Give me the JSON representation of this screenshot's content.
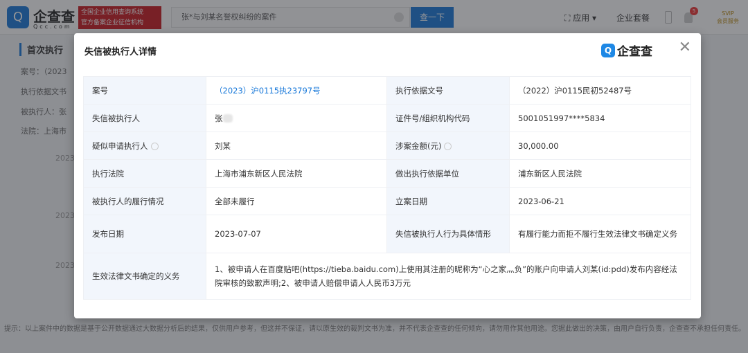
{
  "header": {
    "logo_text": "企查查",
    "logo_sub": "Qcc.com",
    "promo": [
      "全国企业信用查询系统",
      "官方备案企业征信机构"
    ],
    "search_value": "张*与刘某名誉权纠纷的案件",
    "search_button": "查一下",
    "nav_apps": "应用",
    "nav_pkg": "企业套餐",
    "notif_count": "5",
    "svip": [
      "SVIP",
      "会员服务"
    ]
  },
  "background": {
    "section": "首次执行",
    "lines": [
      "案号：（2023",
      "执行依据文书",
      "被执行人：张",
      "法院：上海市"
    ],
    "years": [
      "2023",
      "2023",
      "2023"
    ],
    "footer": "提示：以上案件中的数据是基于公开数据通过大数据分析后的结果，仅供用户参考，但这并不保证，请以原生效的裁判文书为准，并不代表企查查的任何倾向，请勿用作其他用途。您据此做出的决策，由用户自行负责，企查查不承担任何责任。"
  },
  "modal": {
    "title": "失信被执行人详情",
    "brand": "企查查",
    "rows": [
      {
        "l1": "案号",
        "v1": "（2023）沪0115执23797号",
        "l2": "执行依据文号",
        "v2": "（2022）沪0115民初52487号"
      },
      {
        "l1": "失信被执行人",
        "v1": "张",
        "l2": "证件号/组织机构代码",
        "v2": "5001051997****5834"
      },
      {
        "l1": "疑似申请执行人",
        "v1": "刘某",
        "l2": "涉案金额(元)",
        "v2": "30,000.00"
      },
      {
        "l1": "执行法院",
        "v1": "上海市浦东新区人民法院",
        "l2": "做出执行依据单位",
        "v2": "浦东新区人民法院"
      },
      {
        "l1": "被执行人的履行情况",
        "v1": "全部未履行",
        "l2": "立案日期",
        "v2": "2023-06-21"
      },
      {
        "l1": "发布日期",
        "v1": "2023-07-07",
        "l2": "失信被执行人行为具体情形",
        "v2": "有履行能力而拒不履行生效法律文书确定义务"
      }
    ],
    "duty_label": "生效法律文书确定的义务",
    "duty_value": "1、被申请人在百度贴吧(https://tieba.baidu.com)上使用其注册的昵称为“心之家灬负”的账户向申请人刘某(id:pdd)发布内容经法院审核的致歉声明;2、被申请人赔偿申请人人民币3万元"
  }
}
